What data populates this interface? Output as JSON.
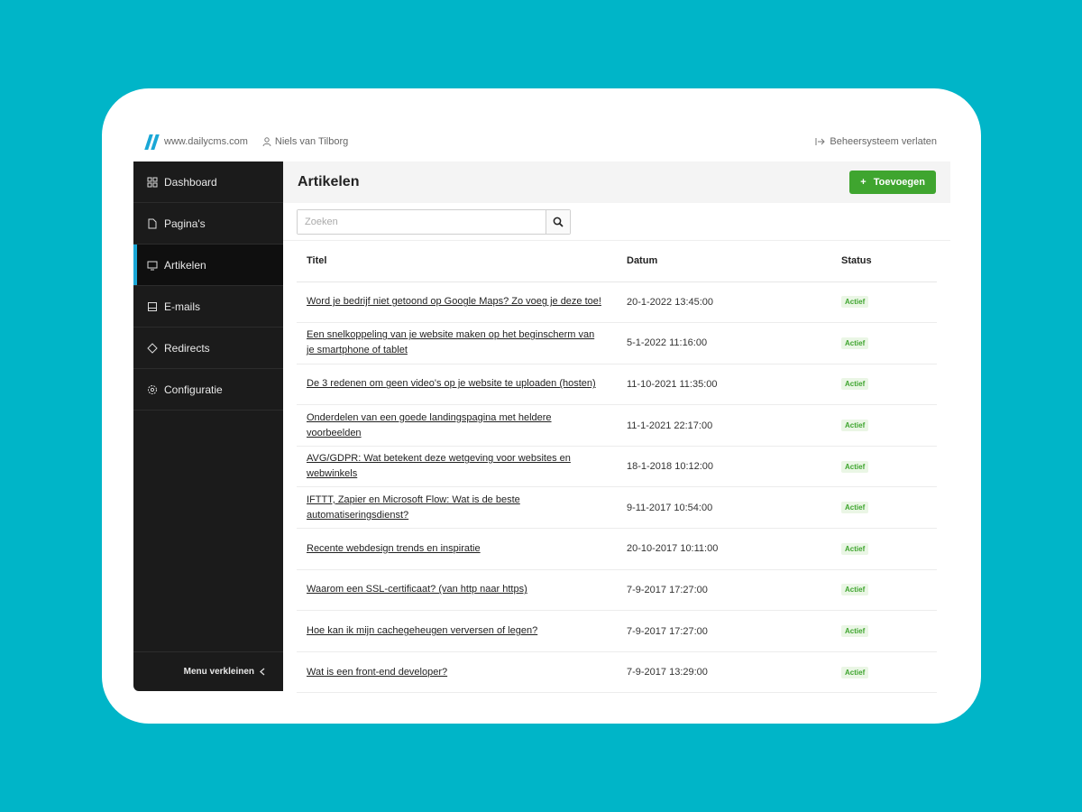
{
  "topbar": {
    "site_url": "www.dailycms.com",
    "user_name": "Niels van Tilborg",
    "logout_label": "Beheersysteem verlaten"
  },
  "sidebar": {
    "items": [
      {
        "label": "Dashboard",
        "icon": "dashboard-icon"
      },
      {
        "label": "Pagina's",
        "icon": "page-icon"
      },
      {
        "label": "Artikelen",
        "icon": "articles-icon",
        "active": true
      },
      {
        "label": "E-mails",
        "icon": "email-icon"
      },
      {
        "label": "Redirects",
        "icon": "redirect-icon"
      },
      {
        "label": "Configuratie",
        "icon": "gear-icon"
      }
    ],
    "collapse_label": "Menu verkleinen"
  },
  "main": {
    "title": "Artikelen",
    "add_label": "Toevoegen",
    "search_placeholder": "Zoeken",
    "columns": [
      "Titel",
      "Datum",
      "Status"
    ],
    "rows": [
      {
        "title": "Word je bedrijf niet getoond op Google Maps? Zo voeg je deze toe!",
        "date": "20-1-2022 13:45:00",
        "status": "Actief"
      },
      {
        "title": "Een snelkoppeling van je website maken op het beginscherm van je smartphone of tablet",
        "date": "5-1-2022 11:16:00",
        "status": "Actief"
      },
      {
        "title": "De 3 redenen om geen video's op je website te uploaden (hosten)",
        "date": "11-10-2021 11:35:00",
        "status": "Actief"
      },
      {
        "title": "Onderdelen van een goede landingspagina met heldere voorbeelden",
        "date": "11-1-2021 22:17:00",
        "status": "Actief"
      },
      {
        "title": "AVG/GDPR: Wat betekent deze wetgeving voor websites en webwinkels",
        "date": "18-1-2018 10:12:00",
        "status": "Actief"
      },
      {
        "title": "IFTTT, Zapier en Microsoft Flow: Wat is de beste automatiseringsdienst?",
        "date": "9-11-2017 10:54:00",
        "status": "Actief"
      },
      {
        "title": "Recente webdesign trends en inspiratie",
        "date": "20-10-2017 10:11:00",
        "status": "Actief"
      },
      {
        "title": "Waarom een SSL-certificaat? (van http naar https)",
        "date": "7-9-2017 17:27:00",
        "status": "Actief"
      },
      {
        "title": "Hoe kan ik mijn cachegeheugen verversen of legen?",
        "date": "7-9-2017 17:27:00",
        "status": "Actief"
      },
      {
        "title": "Wat is een front-end developer?",
        "date": "7-9-2017 13:29:00",
        "status": "Actief"
      }
    ]
  },
  "colors": {
    "background": "#00b5c8",
    "sidebar": "#1b1b1b",
    "accent": "#1aa7d6",
    "primary_button": "#3fa52f"
  }
}
